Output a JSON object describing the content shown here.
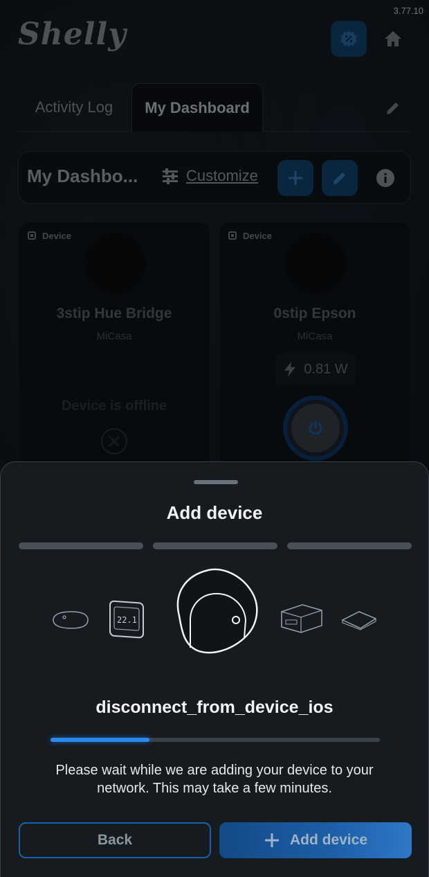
{
  "app": {
    "version": "3.77.10",
    "logo_text": "Shelly"
  },
  "header": {
    "promo_icon": "percent-badge-icon",
    "home_icon": "home-icon"
  },
  "tabs": [
    {
      "label": "Activity Log",
      "active": false
    },
    {
      "label": "My Dashboard",
      "active": true
    }
  ],
  "dashboard_bar": {
    "title": "My Dashbo...",
    "customize_label": "Customize"
  },
  "cards": [
    {
      "chip": "Device",
      "name": "3stip Hue Bridge",
      "room": "MiCasa",
      "offline_text": "Device is offline"
    },
    {
      "chip": "Device",
      "name": "0stip Epson",
      "room": "MiCasa",
      "power": "0.81 W"
    }
  ],
  "sheet": {
    "title": "Add device",
    "step_count": 3,
    "status_title": "disconnect_from_device_ios",
    "progress": 0.3,
    "description": "Please wait while we are adding your device to your network. This may take a few minutes.",
    "back_label": "Back",
    "add_label": "Add device"
  },
  "colors": {
    "accent": "#2a8af0",
    "sheet_bg": "#161b20",
    "button_blue": "#1d5fa8"
  }
}
